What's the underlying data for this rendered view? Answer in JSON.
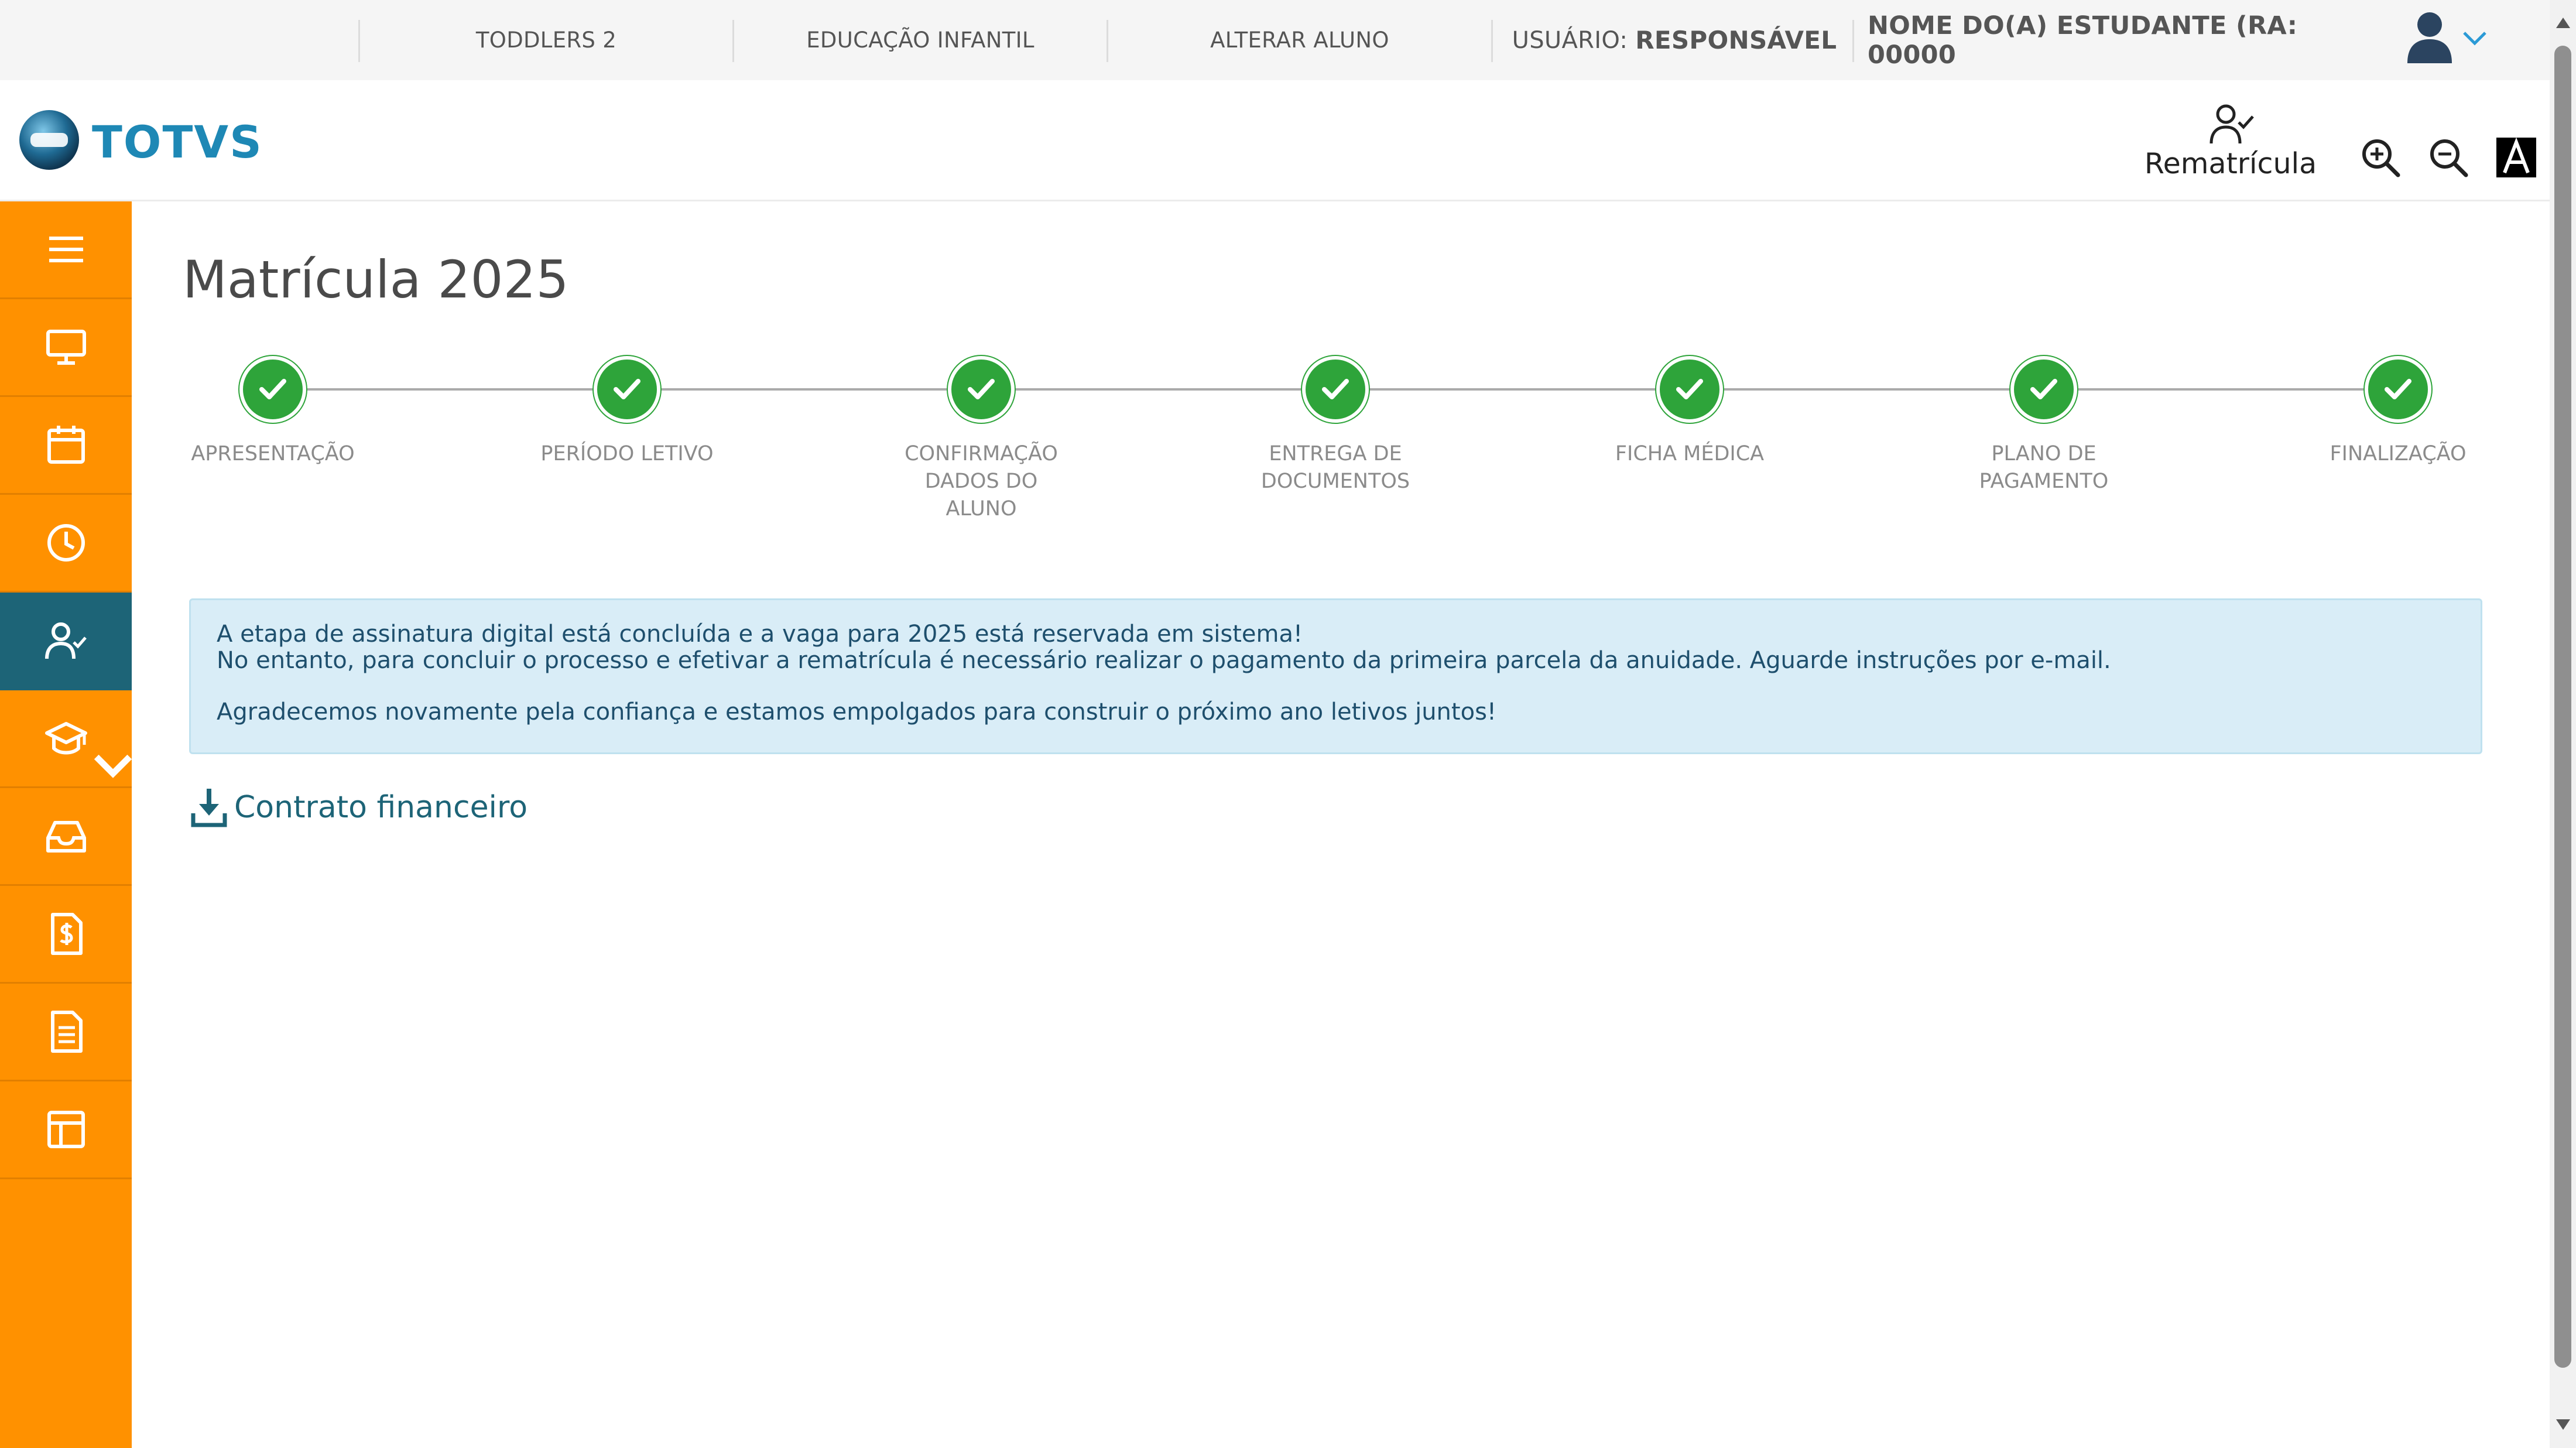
{
  "topbar": {
    "class_name": "TODDLERS 2",
    "segment": "EDUCAÇÃO INFANTIL",
    "change_student": "ALTERAR ALUNO",
    "user_prefix": "USUÁRIO:",
    "user_role": "RESPONSÁVEL",
    "student_name": "NOME DO(A) ESTUDANTE (RA: 00000"
  },
  "header": {
    "logo_text": "TOTVS",
    "rematricula_label": "Rematrícula"
  },
  "icons": {
    "zoom_in": "zoom-in-icon",
    "zoom_out": "zoom-out-icon",
    "contrast": "contrast-icon"
  },
  "sidebar": {
    "items": [
      {
        "icon": "menu-icon"
      },
      {
        "icon": "monitor-icon"
      },
      {
        "icon": "calendar-icon"
      },
      {
        "icon": "clock-icon"
      },
      {
        "icon": "user-check-icon",
        "active": true
      },
      {
        "icon": "graduation-cap-icon"
      },
      {
        "icon": "inbox-icon"
      },
      {
        "icon": "invoice-dollar-icon"
      },
      {
        "icon": "document-list-icon"
      },
      {
        "icon": "layout-icon"
      }
    ]
  },
  "main": {
    "title": "Matrícula 2025",
    "steps": [
      {
        "label": "APRESENTAÇÃO",
        "status": "complete"
      },
      {
        "label": "PERÍODO LETIVO",
        "status": "complete"
      },
      {
        "label": "CONFIRMAÇÃO DADOS DO ALUNO",
        "status": "complete"
      },
      {
        "label": "ENTREGA DE DOCUMENTOS",
        "status": "complete"
      },
      {
        "label": "FICHA MÉDICA",
        "status": "complete"
      },
      {
        "label": "PLANO DE PAGAMENTO",
        "status": "complete"
      },
      {
        "label": "FINALIZAÇÃO",
        "status": "complete"
      }
    ],
    "info": {
      "line1": "A etapa de assinatura digital está concluída e a vaga para 2025 está reservada em sistema!",
      "line2": "No entanto, para concluir o processo e efetivar a rematrícula é necessário realizar o pagamento da primeira parcela da anuidade. Aguarde instruções por e-mail.",
      "line3": "Agradecemos novamente pela confiança e estamos empolgados para construir o próximo ano letivos juntos!"
    },
    "contract_link": "Contrato financeiro"
  },
  "colors": {
    "sidebar": "#ff9100",
    "sidebar_active": "#1d6477",
    "step_complete": "#2ea43a",
    "info_bg": "#d9edf7",
    "info_text": "#1e4f6d",
    "link": "#1d6477"
  }
}
